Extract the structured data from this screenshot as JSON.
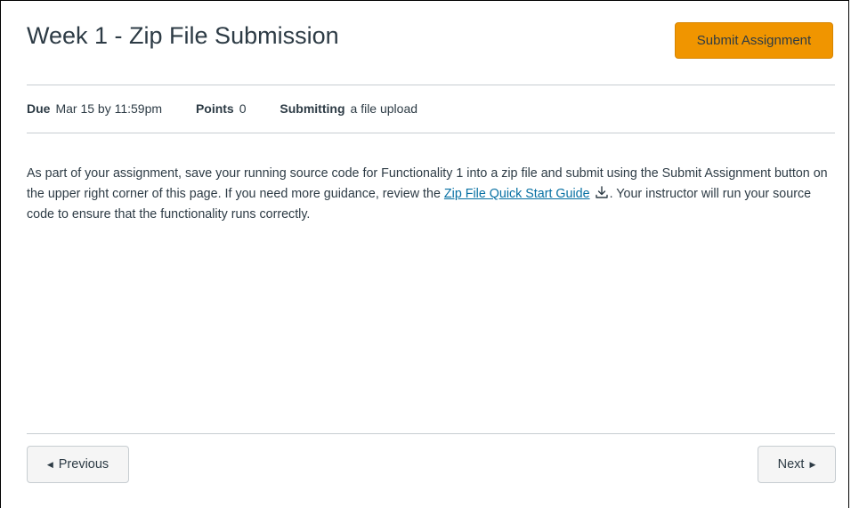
{
  "assignment": {
    "title": "Week 1 - Zip File Submission",
    "submit_label": "Submit Assignment"
  },
  "details": {
    "due_label": "Due",
    "due_value": "Mar 15 by 11:59pm",
    "points_label": "Points",
    "points_value": "0",
    "submitting_label": "Submitting",
    "submitting_value": "a file upload"
  },
  "description": {
    "text_before": "As part of your assignment, save your running source code for Functionality 1 into a zip file and submit using the Submit Assignment button on the upper right corner of this page. If you need more guidance, review the ",
    "link_text": "Zip File Quick Start Guide",
    "text_after": ". Your instructor will run your source code to ensure that the functionality runs correctly."
  },
  "navigation": {
    "previous_label": "Previous",
    "next_label": "Next"
  },
  "colors": {
    "accent": "#f09500",
    "link": "#0770a3",
    "text": "#2d3b45"
  },
  "icons": {
    "download": "download-icon",
    "previous": "caret-left-icon",
    "next": "caret-right-icon"
  }
}
